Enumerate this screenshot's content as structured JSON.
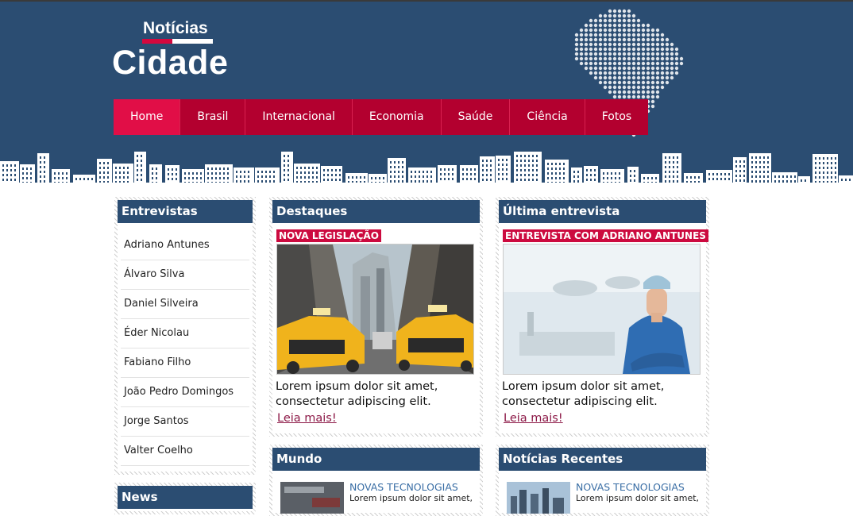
{
  "logo": {
    "top": "Notícias",
    "main": "Cidade"
  },
  "nav": [
    {
      "label": "Home",
      "active": true
    },
    {
      "label": "Brasil"
    },
    {
      "label": "Internacional"
    },
    {
      "label": "Economia"
    },
    {
      "label": "Saúde"
    },
    {
      "label": "Ciência"
    },
    {
      "label": "Fotos"
    }
  ],
  "entrevistas": {
    "title": "Entrevistas",
    "items": [
      "Adriano Antunes",
      "Álvaro Silva",
      "Daniel Silveira",
      "Éder Nicolau",
      "Fabiano Filho",
      "João Pedro Domingos",
      "Jorge Santos",
      "Valter Coelho"
    ]
  },
  "news": {
    "title": "News"
  },
  "destaques": {
    "title": "Destaques",
    "tag": "NOVA LEGISLAÇÃO",
    "text": "Lorem ipsum dolor sit amet, consectetur adipiscing elit.",
    "link": "Leia mais!"
  },
  "ultima": {
    "title": "Última entrevista",
    "tag": "ENTREVISTA COM ADRIANO ANTUNES",
    "text": "Lorem ipsum dolor sit amet, consectetur adipiscing elit.",
    "link": "Leia mais!"
  },
  "mundo": {
    "title": "Mundo",
    "headline": "NOVAS TECNOLOGIAS",
    "sub": "Lorem ipsum dolor sit amet,"
  },
  "recentes": {
    "title": "Notícias Recentes",
    "headline": "NOVAS TECNOLOGIAS",
    "sub": "Lorem ipsum dolor sit amet,"
  },
  "colors": {
    "header": "#2b4d72",
    "nav": "#b3002f",
    "nav_active": "#e10e47",
    "tag": "#cc0a3f",
    "link": "#8c1846"
  }
}
